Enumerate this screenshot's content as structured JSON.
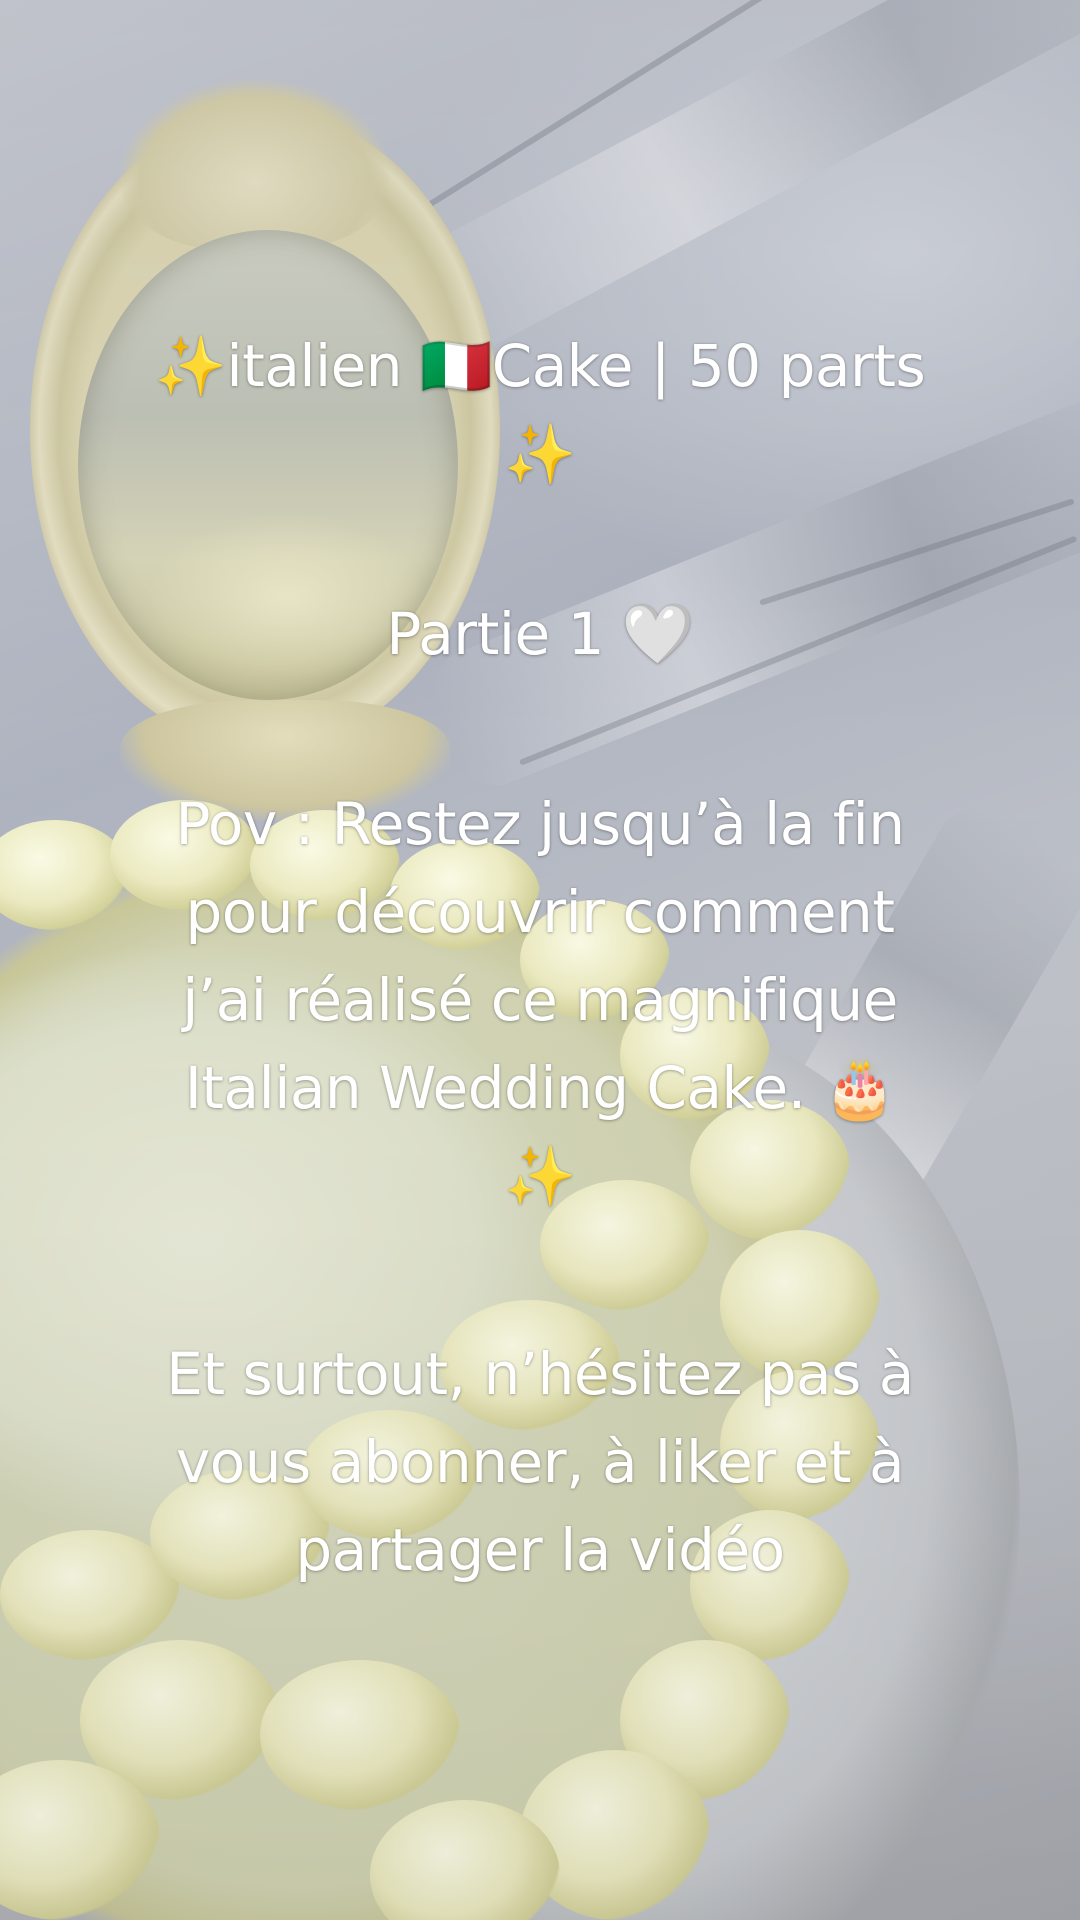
{
  "caption": {
    "title": "✨italien 🇮🇹Cake | 50 parts\n✨",
    "part": "Partie 1 🤍",
    "pov": "Pov : Restez jusqu’à la fin\npour découvrir comment\nj’ai réalisé ce magnifique\nItalian Wedding Cake. 🎂\n✨",
    "cta": "Et surtout, n’hésitez pas à\nvous abonner, à liker et à\npartager la vidéo"
  },
  "colors": {
    "caption_text": "#ffffff",
    "cream": "#ecebc2",
    "fabric": "#b9bcc4"
  }
}
